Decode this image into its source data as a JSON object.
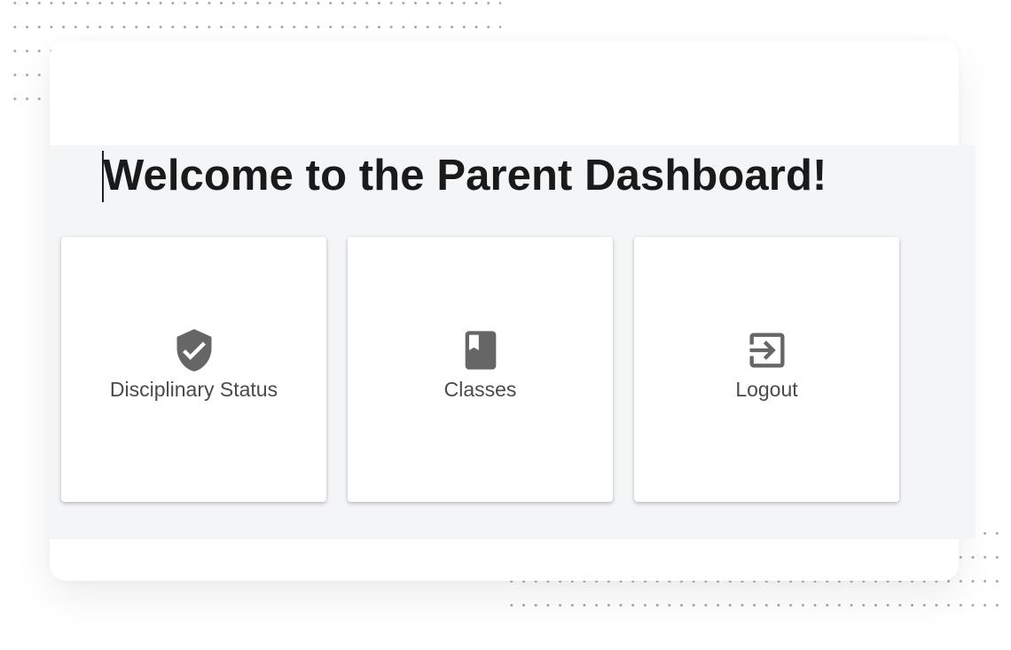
{
  "page": {
    "title": "Welcome to the Parent Dashboard!"
  },
  "cards": [
    {
      "label": "Disciplinary Status",
      "icon": "shield-check-icon"
    },
    {
      "label": "Classes",
      "icon": "book-icon"
    },
    {
      "label": "Logout",
      "icon": "logout-icon"
    }
  ],
  "colors": {
    "background": "#ffffff",
    "content_background": "#f4f5f7",
    "card_background": "#ffffff",
    "icon": "#666666",
    "title_text": "#1a1a1a",
    "label_text": "#4a4a4a"
  }
}
